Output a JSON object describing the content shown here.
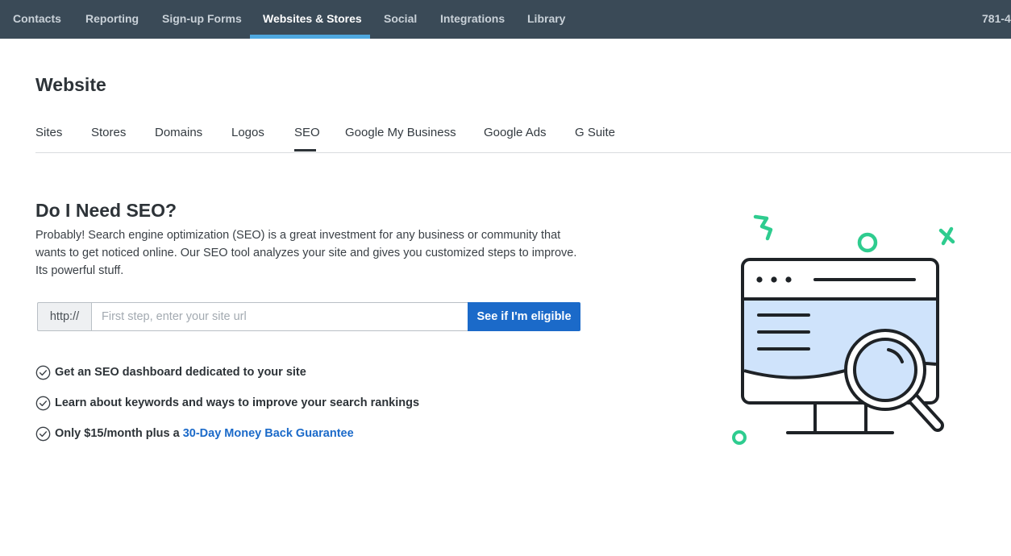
{
  "topnav": {
    "items": [
      {
        "label": "Contacts",
        "active": false
      },
      {
        "label": "Reporting",
        "active": false
      },
      {
        "label": "Sign-up Forms",
        "active": false
      },
      {
        "label": "Websites & Stores",
        "active": true
      },
      {
        "label": "Social",
        "active": false
      },
      {
        "label": "Integrations",
        "active": false
      },
      {
        "label": "Library",
        "active": false
      }
    ],
    "phone": "781-4"
  },
  "page": {
    "title": "Website"
  },
  "subtabs": {
    "items": [
      {
        "label": "Sites"
      },
      {
        "label": "Stores"
      },
      {
        "label": "Domains"
      },
      {
        "label": "Logos"
      },
      {
        "label": "SEO",
        "active": true
      },
      {
        "label": "Google My Business"
      },
      {
        "label": "Google Ads"
      },
      {
        "label": "G Suite"
      }
    ]
  },
  "seo": {
    "heading": "Do I Need SEO?",
    "description": "Probably! Search engine optimization (SEO) is a great investment for any business or community that wants to get noticed online. Our SEO tool analyzes your site and gives you customized steps to improve. Its powerful stuff.",
    "url_prefix": "http://",
    "url_placeholder": "First step, enter your site url",
    "url_value": "",
    "button_label": "See if I'm eligible",
    "benefits": [
      {
        "text": "Get an SEO dashboard dedicated to your site"
      },
      {
        "text": "Learn about keywords and ways to improve your search rankings"
      },
      {
        "text": "Only $15/month plus a",
        "link": "30-Day Money Back Guarantee"
      }
    ]
  },
  "icons": {
    "benefit_icon": "check-circle-icon",
    "illustration": "website-magnifier-illustration"
  },
  "colors": {
    "nav_bg": "#3a4a57",
    "nav_active_bar": "#4ea8df",
    "primary_button": "#1b6ac9",
    "link": "#1b6ac9",
    "accent_green": "#2ecc8f",
    "screen_fill": "#cfe3fb"
  }
}
